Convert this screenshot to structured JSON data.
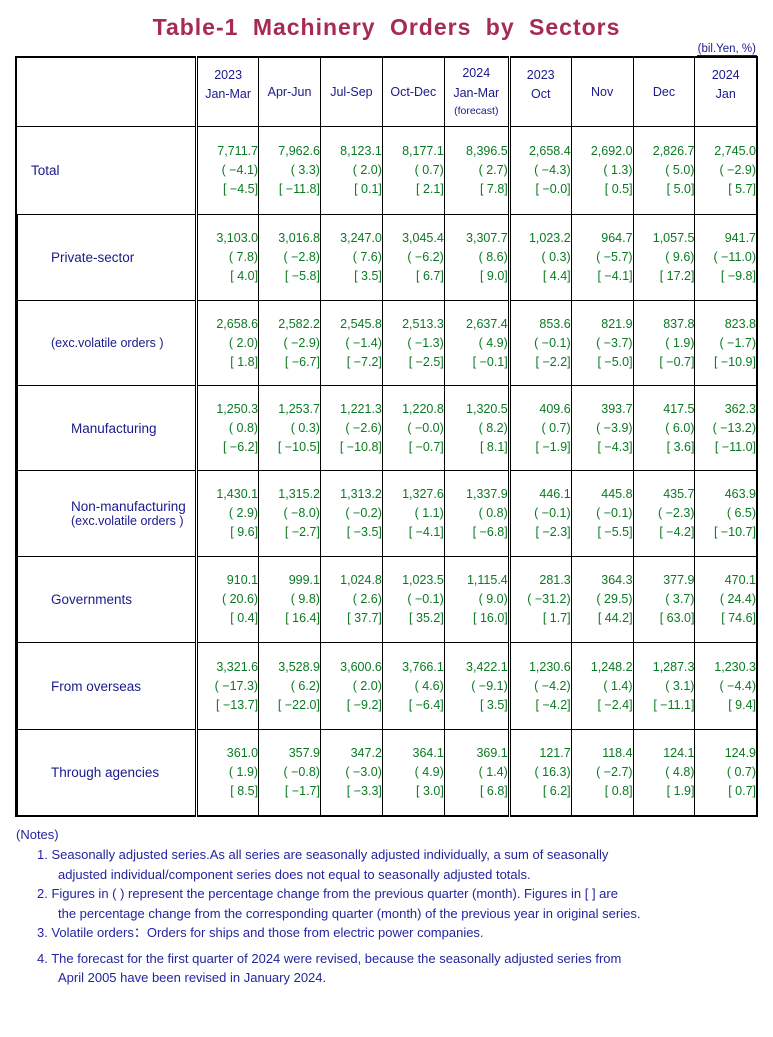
{
  "title": "Table-1  Machinery  Orders  by  Sectors",
  "unit_note": "(bil.Yen, %)",
  "header": {
    "corner": "",
    "columns": [
      {
        "year": "2023",
        "period": "Jan-Mar",
        "note": ""
      },
      {
        "year": "",
        "period": "Apr-Jun",
        "note": ""
      },
      {
        "year": "",
        "period": "Jul-Sep",
        "note": ""
      },
      {
        "year": "",
        "period": "Oct-Dec",
        "note": ""
      },
      {
        "year": "2024",
        "period": "Jan-Mar",
        "note": "(forecast)"
      },
      {
        "year": "2023",
        "period": "Oct",
        "note": ""
      },
      {
        "year": "",
        "period": "Nov",
        "note": ""
      },
      {
        "year": "",
        "period": "Dec",
        "note": ""
      },
      {
        "year": "2024",
        "period": "Jan",
        "note": ""
      }
    ]
  },
  "rows": [
    {
      "label": "Total",
      "sublabel": "",
      "indent": 0,
      "values": [
        [
          "7,711.7",
          "( −4.1)",
          "[ −4.5]"
        ],
        [
          "7,962.6",
          "( 3.3)",
          "[ −11.8]"
        ],
        [
          "8,123.1",
          "( 2.0)",
          "[ 0.1]"
        ],
        [
          "8,177.1",
          "( 0.7)",
          "[ 2.1]"
        ],
        [
          "8,396.5",
          "( 2.7)",
          "[ 7.8]"
        ],
        [
          "2,658.4",
          "( −4.3)",
          "[ −0.0]"
        ],
        [
          "2,692.0",
          "( 1.3)",
          "[ 0.5]"
        ],
        [
          "2,826.7",
          "( 5.0)",
          "[ 5.0]"
        ],
        [
          "2,745.0",
          "( −2.9)",
          "[ 5.7]"
        ]
      ]
    },
    {
      "label": "Private-sector",
      "sublabel": "",
      "indent": 1,
      "values": [
        [
          "3,103.0",
          "( 7.8)",
          "[ 4.0]"
        ],
        [
          "3,016.8",
          "( −2.8)",
          "[ −5.8]"
        ],
        [
          "3,247.0",
          "( 7.6)",
          "[ 3.5]"
        ],
        [
          "3,045.4",
          "( −6.2)",
          "[ 6.7]"
        ],
        [
          "3,307.7",
          "( 8.6)",
          "[ 9.0]"
        ],
        [
          "1,023.2",
          "( 0.3)",
          "[ 4.4]"
        ],
        [
          "964.7",
          "( −5.7)",
          "[ −4.1]"
        ],
        [
          "1,057.5",
          "( 9.6)",
          "[ 17.2]"
        ],
        [
          "941.7",
          "( −11.0)",
          "[ −9.8]"
        ]
      ]
    },
    {
      "label": "",
      "sublabel": "(exc.volatile orders )",
      "indent": 1,
      "values": [
        [
          "2,658.6",
          "( 2.0)",
          "[ 1.8]"
        ],
        [
          "2,582.2",
          "( −2.9)",
          "[ −6.7]"
        ],
        [
          "2,545.8",
          "( −1.4)",
          "[ −7.2]"
        ],
        [
          "2,513.3",
          "( −1.3)",
          "[ −2.5]"
        ],
        [
          "2,637.4",
          "( 4.9)",
          "[ −0.1]"
        ],
        [
          "853.6",
          "( −0.1)",
          "[ −2.2]"
        ],
        [
          "821.9",
          "( −3.7)",
          "[ −5.0]"
        ],
        [
          "837.8",
          "( 1.9)",
          "[ −0.7]"
        ],
        [
          "823.8",
          "( −1.7)",
          "[ −10.9]"
        ]
      ]
    },
    {
      "label": "Manufacturing",
      "sublabel": "",
      "indent": 2,
      "values": [
        [
          "1,250.3",
          "( 0.8)",
          "[ −6.2]"
        ],
        [
          "1,253.7",
          "( 0.3)",
          "[ −10.5]"
        ],
        [
          "1,221.3",
          "( −2.6)",
          "[ −10.8]"
        ],
        [
          "1,220.8",
          "( −0.0)",
          "[ −0.7]"
        ],
        [
          "1,320.5",
          "( 8.2)",
          "[ 8.1]"
        ],
        [
          "409.6",
          "( 0.7)",
          "[ −1.9]"
        ],
        [
          "393.7",
          "( −3.9)",
          "[ −4.3]"
        ],
        [
          "417.5",
          "( 6.0)",
          "[ 3.6]"
        ],
        [
          "362.3",
          "( −13.2)",
          "[ −11.0]"
        ]
      ]
    },
    {
      "label": "Non-manufacturing",
      "sublabel": "(exc.volatile orders )",
      "indent": 2,
      "values": [
        [
          "1,430.1",
          "( 2.9)",
          "[ 9.6]"
        ],
        [
          "1,315.2",
          "( −8.0)",
          "[ −2.7]"
        ],
        [
          "1,313.2",
          "( −0.2)",
          "[ −3.5]"
        ],
        [
          "1,327.6",
          "( 1.1)",
          "[ −4.1]"
        ],
        [
          "1,337.9",
          "( 0.8)",
          "[ −6.8]"
        ],
        [
          "446.1",
          "( −0.1)",
          "[ −2.3]"
        ],
        [
          "445.8",
          "( −0.1)",
          "[ −5.5]"
        ],
        [
          "435.7",
          "( −2.3)",
          "[ −4.2]"
        ],
        [
          "463.9",
          "( 6.5)",
          "[ −10.7]"
        ]
      ]
    },
    {
      "label": "Governments",
      "sublabel": "",
      "indent": 1,
      "values": [
        [
          "910.1",
          "( 20.6)",
          "[ 0.4]"
        ],
        [
          "999.1",
          "( 9.8)",
          "[ 16.4]"
        ],
        [
          "1,024.8",
          "( 2.6)",
          "[ 37.7]"
        ],
        [
          "1,023.5",
          "( −0.1)",
          "[ 35.2]"
        ],
        [
          "1,115.4",
          "( 9.0)",
          "[ 16.0]"
        ],
        [
          "281.3",
          "( −31.2)",
          "[ 1.7]"
        ],
        [
          "364.3",
          "( 29.5)",
          "[ 44.2]"
        ],
        [
          "377.9",
          "( 3.7)",
          "[ 63.0]"
        ],
        [
          "470.1",
          "( 24.4)",
          "[ 74.6]"
        ]
      ]
    },
    {
      "label": "From overseas",
      "sublabel": "",
      "indent": 1,
      "values": [
        [
          "3,321.6",
          "( −17.3)",
          "[ −13.7]"
        ],
        [
          "3,528.9",
          "( 6.2)",
          "[ −22.0]"
        ],
        [
          "3,600.6",
          "( 2.0)",
          "[ −9.2]"
        ],
        [
          "3,766.1",
          "( 4.6)",
          "[ −6.4]"
        ],
        [
          "3,422.1",
          "( −9.1)",
          "[ 3.5]"
        ],
        [
          "1,230.6",
          "( −4.2)",
          "[ −4.2]"
        ],
        [
          "1,248.2",
          "( 1.4)",
          "[ −2.4]"
        ],
        [
          "1,287.3",
          "( 3.1)",
          "[ −11.1]"
        ],
        [
          "1,230.3",
          "( −4.4)",
          "[ 9.4]"
        ]
      ]
    },
    {
      "label": "Through agencies",
      "sublabel": "",
      "indent": 1,
      "values": [
        [
          "361.0",
          "( 1.9)",
          "[ 8.5]"
        ],
        [
          "357.9",
          "( −0.8)",
          "[ −1.7]"
        ],
        [
          "347.2",
          "( −3.0)",
          "[ −3.3]"
        ],
        [
          "364.1",
          "( 4.9)",
          "[ 3.0]"
        ],
        [
          "369.1",
          "( 1.4)",
          "[ 6.8]"
        ],
        [
          "121.7",
          "( 16.3)",
          "[ 6.2]"
        ],
        [
          "118.4",
          "( −2.7)",
          "[ 0.8]"
        ],
        [
          "124.1",
          "( 4.8)",
          "[ 1.9]"
        ],
        [
          "124.9",
          "( 0.7)",
          "[ 0.7]"
        ]
      ]
    }
  ],
  "notes": {
    "heading": "(Notes)",
    "items": [
      {
        "num": "1.",
        "line1": "Seasonally adjusted series.As all series are seasonally adjusted individually, a sum of seasonally",
        "line2": "adjusted individual/component series does not equal to seasonally adjusted totals."
      },
      {
        "num": "2.",
        "line1": "Figures in ( ) represent the percentage change from the previous quarter (month). Figures in [ ] are",
        "line2": "the percentage change from the corresponding quarter (month) of the previous year in original series."
      },
      {
        "num": "3.",
        "line1": "Volatile orders：Orders for ships and those from electric power companies.",
        "line2": ""
      },
      {
        "num": "4.",
        "line1": "The forecast for the first quarter of 2024 were revised, because the seasonally adjusted series from",
        "line2": "April 2005 have been revised in January 2024."
      }
    ]
  },
  "colors": {
    "title": "#a62a56",
    "label": "#1a1a8c",
    "number": "#0a7a22",
    "note": "#2424a0",
    "border": "#000000"
  }
}
